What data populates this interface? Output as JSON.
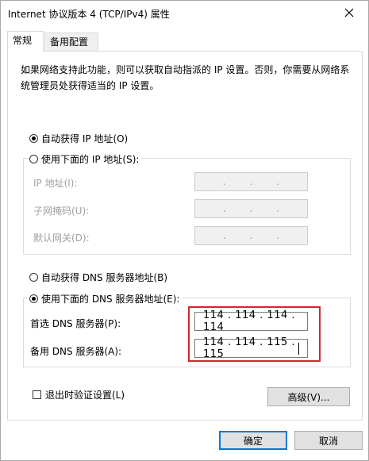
{
  "window": {
    "title": "Internet 协议版本 4 (TCP/IPv4) 属性"
  },
  "tabs": [
    {
      "label": "常规",
      "active": true
    },
    {
      "label": "备用配置",
      "active": false
    }
  ],
  "description": "如果网络支持此功能，则可以获取自动指派的 IP 设置。否则，你需要从网络系统管理员处获得适当的 IP 设置。",
  "ip_section": {
    "auto_radio": {
      "label": "自动获得 IP 地址(O)",
      "selected": true
    },
    "manual_radio": {
      "label": "使用下面的 IP 地址(S):",
      "selected": false
    },
    "fields": [
      {
        "label": "IP 地址(I):",
        "value": ". . ."
      },
      {
        "label": "子网掩码(U):",
        "value": ". . ."
      },
      {
        "label": "默认网关(D):",
        "value": ". . ."
      }
    ]
  },
  "dns_section": {
    "auto_radio": {
      "label": "自动获得 DNS 服务器地址(B)",
      "selected": false
    },
    "manual_radio": {
      "label": "使用下面的 DNS 服务器地址(E):",
      "selected": true
    },
    "preferred": {
      "label": "首选 DNS 服务器(P):",
      "value": "114 . 114 . 114 . 114"
    },
    "alternate": {
      "label": "备用 DNS 服务器(A):",
      "value": "114 . 114 . 115 . 115"
    }
  },
  "validate_checkbox": {
    "label": "退出时验证设置(L)",
    "checked": false
  },
  "buttons": {
    "advanced": "高级(V)...",
    "ok": "确定",
    "cancel": "取消"
  },
  "colors": {
    "highlight": "#d2282e",
    "accent": "#0078d7"
  }
}
